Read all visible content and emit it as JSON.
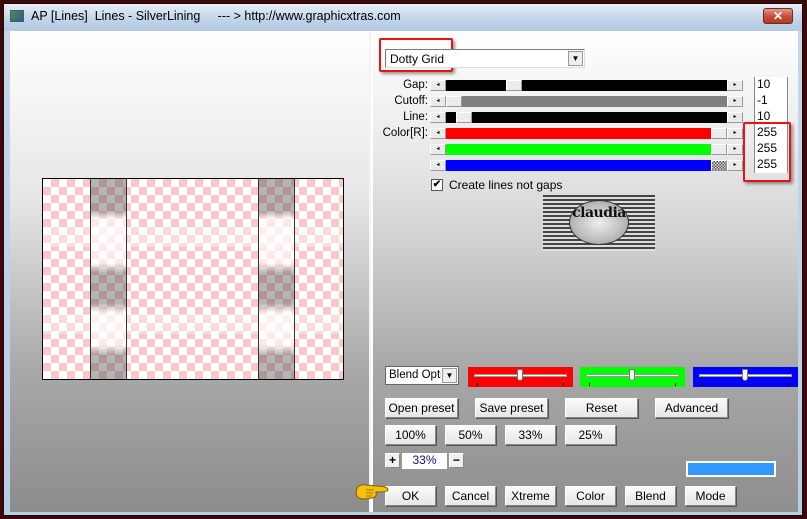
{
  "window": {
    "title": "AP [Lines]  Lines - SilverLining     --- > http://www.graphicxtras.com",
    "close_icon": "close-icon"
  },
  "preset": {
    "selected": "Dotty Grid"
  },
  "params": [
    {
      "label": "Gap:",
      "value": "10",
      "track_color": "#000000",
      "thumb_fraction": 0.22
    },
    {
      "label": "Cutoff:",
      "value": "-1",
      "track_color": "#808080",
      "thumb_fraction": 0.0
    },
    {
      "label": "Line:",
      "value": "10",
      "track_color": "#000000",
      "thumb_fraction": 0.04
    }
  ],
  "color": {
    "label": "Color[R]:",
    "channels": [
      {
        "name": "red",
        "value": "255",
        "color": "#ff0000"
      },
      {
        "name": "green",
        "value": "255",
        "color": "#00ff00"
      },
      {
        "name": "blue",
        "value": "255",
        "color": "#0000ff"
      }
    ]
  },
  "create_lines_checkbox": {
    "label": "Create lines not gaps",
    "checked": true,
    "mark": "✔"
  },
  "logo": {
    "text": "claudia"
  },
  "blend": {
    "selected": "Blend Options",
    "sliders": [
      {
        "name": "red",
        "color": "#ff0000",
        "value_fraction": 0.5
      },
      {
        "name": "green",
        "color": "#00ff00",
        "value_fraction": 0.5
      },
      {
        "name": "blue",
        "color": "#0000ff",
        "value_fraction": 0.5
      }
    ]
  },
  "preset_buttons": {
    "open": "Open preset",
    "save": "Save preset",
    "reset": "Reset",
    "advanced": "Advanced"
  },
  "zoom_buttons": [
    "100%",
    "50%",
    "33%",
    "25%"
  ],
  "zoom_control": {
    "plus": "+",
    "value": "33%",
    "minus": "−"
  },
  "swatch_color": "#3399ff",
  "bottom_buttons": {
    "ok": "OK",
    "cancel": "Cancel",
    "xtreme": "Xtreme",
    "color": "Color",
    "blend": "Blend",
    "mode": "Mode"
  },
  "arrows": {
    "left": "◂",
    "right": "▸",
    "down": "▼"
  }
}
